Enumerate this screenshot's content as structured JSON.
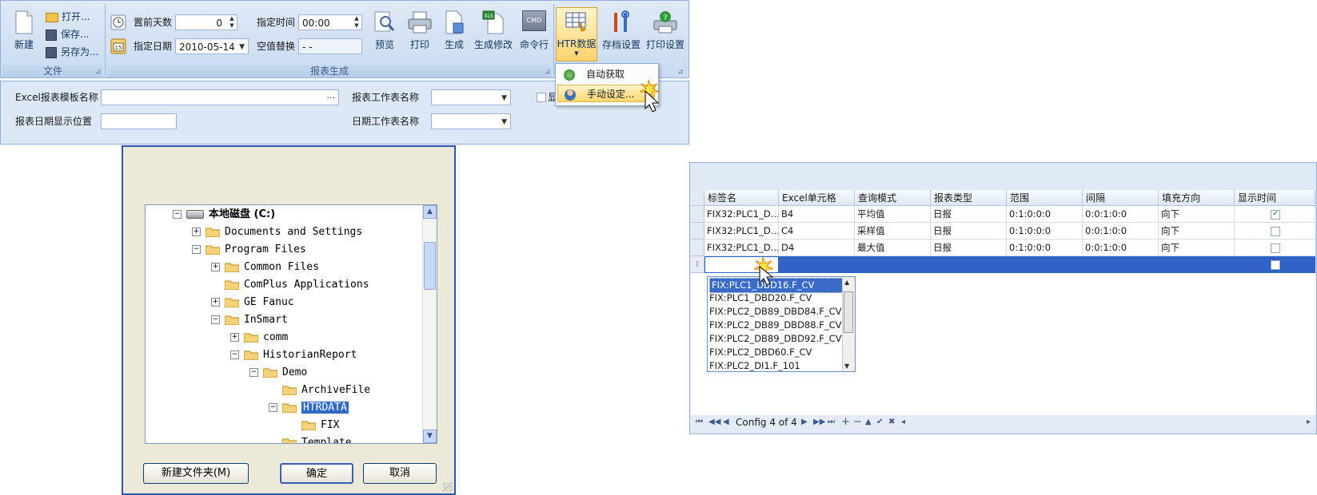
{
  "ribbon": {
    "new_label": "新建",
    "open_label": "打开...",
    "save_label": "保存...",
    "saveas_label": "另存为...",
    "group_file": "文件",
    "group_report": "报表生成",
    "days_before_label": "置前天数",
    "days_before_value": "0",
    "date_label": "指定日期",
    "date_value": "2010-05-14",
    "time_label": "指定时间",
    "time_value": "00:00",
    "null_replace_label": "空值替换",
    "null_replace_value": "- -",
    "preview_label": "预览",
    "print_label": "打印",
    "generate_label": "生成",
    "generate_modify_label": "生成修改",
    "cmd_label": "命令行",
    "cmd_icon_text": "CMD",
    "htr_label": "HTR数据",
    "archive_label": "存档设置",
    "print_setup_label": "打印设置"
  },
  "menu": {
    "auto_label": "自动获取",
    "manual_label": "手动设定..."
  },
  "form": {
    "excel_template_label": "Excel报表模板名称",
    "excel_template_value": "",
    "browse_label": "···",
    "report_sheet_label": "报表工作表名称",
    "date_pos_label": "报表日期显示位置",
    "date_sheet_label": "日期工作表名称",
    "show_label": "显"
  },
  "folder_dialog": {
    "tree": [
      {
        "label": "本地磁盘 (C:)",
        "toggle": "−",
        "level": 0,
        "icon": "drive"
      },
      {
        "label": "Documents and Settings",
        "toggle": "+",
        "level": 1
      },
      {
        "label": "Program Files",
        "toggle": "−",
        "level": 1
      },
      {
        "label": "Common Files",
        "toggle": "+",
        "level": 2
      },
      {
        "label": "ComPlus Applications",
        "toggle": "",
        "level": 2
      },
      {
        "label": "GE Fanuc",
        "toggle": "+",
        "level": 2
      },
      {
        "label": "InSmart",
        "toggle": "−",
        "level": 2
      },
      {
        "label": "comm",
        "toggle": "+",
        "level": 3
      },
      {
        "label": "HistorianReport",
        "toggle": "−",
        "level": 3
      },
      {
        "label": "Demo",
        "toggle": "−",
        "level": 4
      },
      {
        "label": "ArchiveFile",
        "toggle": "",
        "level": 5
      },
      {
        "label": "HTRDATA",
        "toggle": "−",
        "level": 5,
        "selected": true
      },
      {
        "label": "FIX",
        "toggle": "",
        "level": 6
      },
      {
        "label": "Template",
        "toggle": "",
        "level": 5
      }
    ],
    "new_folder_label": "新建文件夹(M)",
    "ok_label": "确定",
    "cancel_label": "取消"
  },
  "grid": {
    "columns": [
      "标签名",
      "Excel单元格",
      "查询模式",
      "报表类型",
      "范围",
      "间隔",
      "填充方向",
      "显示时间"
    ],
    "rows": [
      {
        "tag": "FIX32:PLC1_D...",
        "cell": "B4",
        "mode": "平均值",
        "type": "日报",
        "range": "0:1:0:0:0",
        "interval": "0:0:1:0:0",
        "fill": "向下",
        "show_time": true
      },
      {
        "tag": "FIX32:PLC1_D...",
        "cell": "C4",
        "mode": "采样值",
        "type": "日报",
        "range": "0:1:0:0:0",
        "interval": "0:0:1:0:0",
        "fill": "向下",
        "show_time": false
      },
      {
        "tag": "FIX32:PLC1_D...",
        "cell": "D4",
        "mode": "最大值",
        "type": "日报",
        "range": "0:1:0:0:0",
        "interval": "0:0:1:0:0",
        "fill": "向下",
        "show_time": false
      }
    ],
    "new_row_marker": "I",
    "tag_options": [
      "FIX:PLC1_DBD16.F_CV",
      "FIX:PLC1_DBD20.F_CV",
      "FIX:PLC2_DB89_DBD84.F_CV",
      "FIX:PLC2_DB89_DBD88.F_CV",
      "FIX:PLC2_DB89_DBD92.F_CV",
      "FIX:PLC2_DBD60.F_CV",
      "FIX:PLC2_DI1.F_101"
    ],
    "nav_text": "Config 4 of 4"
  },
  "colors": {
    "ribbon_bg": "#c9dbf1",
    "selection_blue": "#316ac5",
    "grid_active_row": "#2f62c4",
    "menu_hover": "#ffd86e"
  }
}
